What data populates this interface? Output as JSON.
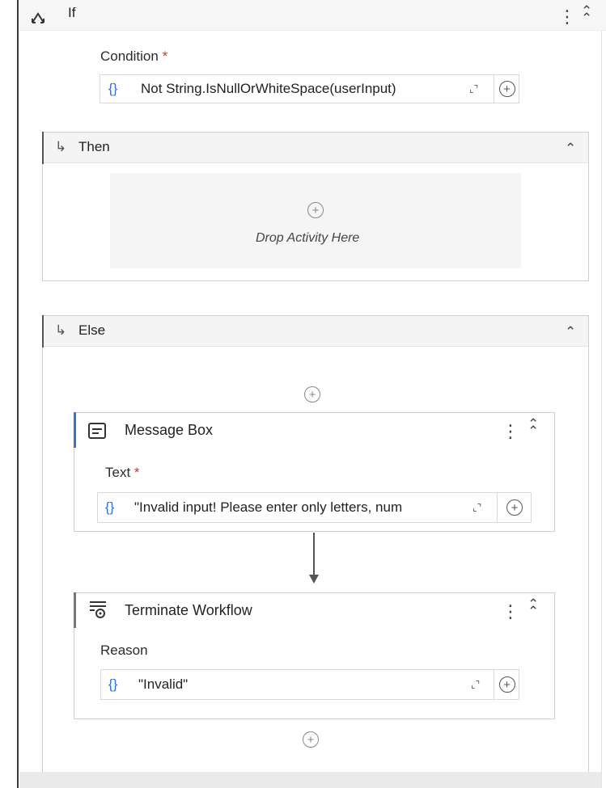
{
  "if_activity": {
    "title": "If",
    "icon": "if-branch-icon",
    "condition_label": "Condition",
    "required_mark": "*",
    "condition_value": "Not String.IsNullOrWhiteSpace(userInput)"
  },
  "then_branch": {
    "title": "Then",
    "drop_text": "Drop Activity Here"
  },
  "else_branch": {
    "title": "Else",
    "message_box": {
      "title": "Message Box",
      "icon": "message-box-icon",
      "field_label": "Text",
      "required_mark": "*",
      "field_value": "\"Invalid input! Please enter only letters, num"
    },
    "terminate": {
      "title": "Terminate Workflow",
      "icon": "terminate-workflow-icon",
      "field_label": "Reason",
      "field_value": "\"Invalid\""
    }
  },
  "glyphs": {
    "braces": "{}",
    "kebab": "⋮",
    "collapse": "⌃",
    "double_collapse": "⌃",
    "branch_arrow": "↳",
    "plus": "+"
  }
}
